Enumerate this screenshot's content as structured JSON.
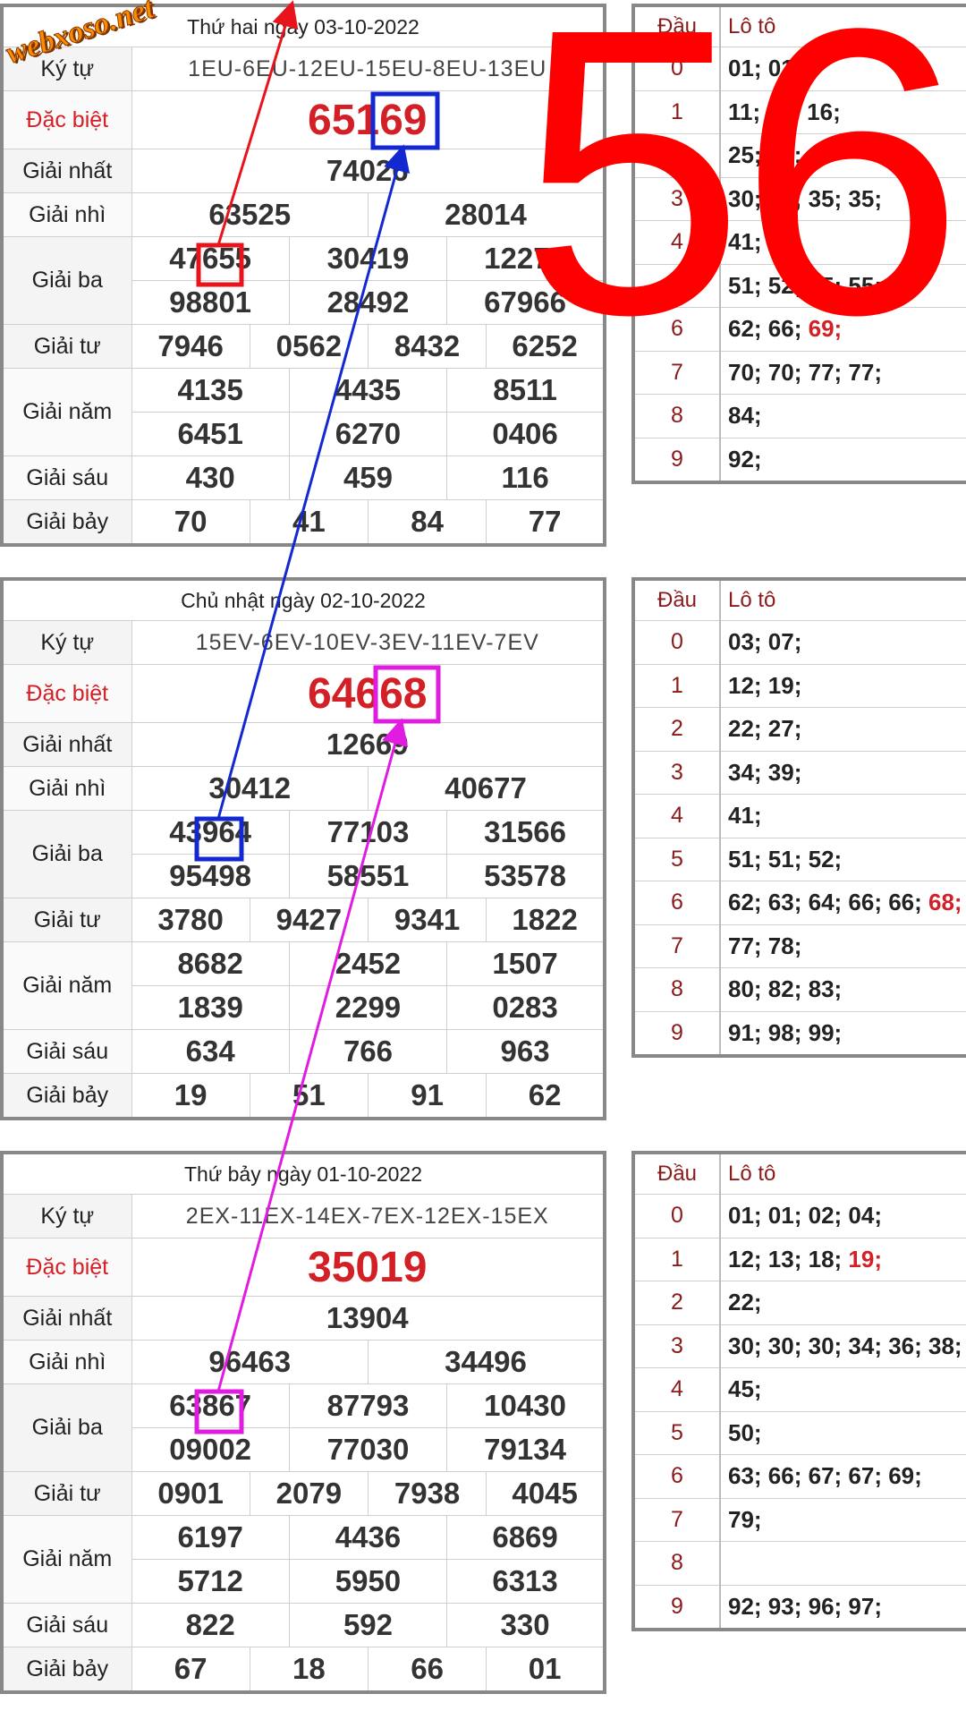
{
  "overlay": {
    "big_number": "56",
    "logo_text": "webxoso.net"
  },
  "labels": {
    "ky_tu": "Ký tự",
    "dac_biet": "Đặc biệt",
    "giai_nhat": "Giải nhất",
    "giai_nhi": "Giải nhì",
    "giai_ba": "Giải ba",
    "giai_tu": "Giải tư",
    "giai_nam": "Giải năm",
    "giai_sau": "Giải sáu",
    "giai_bay": "Giải bảy",
    "dau": "Đầu",
    "loto": "Lô tô"
  },
  "days": [
    {
      "date_title": "Thứ hai ngày 03-10-2022",
      "ky_tu": "1EU-6EU-12EU-15EU-8EU-13EU",
      "dac_biet": "65169",
      "giai_nhat": "74026",
      "giai_nhi": [
        "63525",
        "28014"
      ],
      "giai_ba": [
        "47655",
        "30419",
        "12277",
        "98801",
        "28492",
        "67966"
      ],
      "giai_tu": [
        "7946",
        "0562",
        "8432",
        "6252"
      ],
      "giai_nam": [
        "4135",
        "4435",
        "8511",
        "6451",
        "6270",
        "0406"
      ],
      "giai_sau": [
        "430",
        "459",
        "116"
      ],
      "giai_bay": [
        "70",
        "41",
        "84",
        "77"
      ],
      "loto": [
        {
          "dau": "0",
          "values": "01; 01;",
          "hl": ""
        },
        {
          "dau": "1",
          "values": "11; 14; 16;",
          "hl": ""
        },
        {
          "dau": "2",
          "values": "25; 26;",
          "hl": ""
        },
        {
          "dau": "3",
          "values": "30; 32; 35; 35;",
          "hl": ""
        },
        {
          "dau": "4",
          "values": "41;",
          "hl": ""
        },
        {
          "dau": "5",
          "values": "51; 52; 55; 55;",
          "hl": ""
        },
        {
          "dau": "6",
          "values": "62; 66; ",
          "hl": "69;"
        },
        {
          "dau": "7",
          "values": "70; 70; 77; 77;",
          "hl": ""
        },
        {
          "dau": "8",
          "values": "84;",
          "hl": ""
        },
        {
          "dau": "9",
          "values": "92;",
          "hl": ""
        }
      ]
    },
    {
      "date_title": "Chủ nhật ngày 02-10-2022",
      "ky_tu": "15EV-6EV-10EV-3EV-11EV-7EV",
      "dac_biet": "64668",
      "giai_nhat": "12669",
      "giai_nhi": [
        "30412",
        "40677"
      ],
      "giai_ba": [
        "43964",
        "77103",
        "31566",
        "95498",
        "58551",
        "53578"
      ],
      "giai_tu": [
        "3780",
        "9427",
        "9341",
        "1822"
      ],
      "giai_nam": [
        "8682",
        "2452",
        "1507",
        "1839",
        "2299",
        "0283"
      ],
      "giai_sau": [
        "634",
        "766",
        "963"
      ],
      "giai_bay": [
        "19",
        "51",
        "91",
        "62"
      ],
      "loto": [
        {
          "dau": "0",
          "values": "03; 07;",
          "hl": ""
        },
        {
          "dau": "1",
          "values": "12; 19;",
          "hl": ""
        },
        {
          "dau": "2",
          "values": "22; 27;",
          "hl": ""
        },
        {
          "dau": "3",
          "values": "34; 39;",
          "hl": ""
        },
        {
          "dau": "4",
          "values": "41;",
          "hl": ""
        },
        {
          "dau": "5",
          "values": "51; 51; 52;",
          "hl": ""
        },
        {
          "dau": "6",
          "values": "62; 63; 64; 66; 66; ",
          "hl": "68;"
        },
        {
          "dau": "7",
          "values": "77; 78;",
          "hl": ""
        },
        {
          "dau": "8",
          "values": "80; 82; 83;",
          "hl": ""
        },
        {
          "dau": "9",
          "values": "91; 98; 99;",
          "hl": ""
        }
      ]
    },
    {
      "date_title": "Thứ bảy ngày 01-10-2022",
      "ky_tu": "2EX-11EX-14EX-7EX-12EX-15EX",
      "dac_biet": "35019",
      "giai_nhat": "13904",
      "giai_nhi": [
        "96463",
        "34496"
      ],
      "giai_ba": [
        "63867",
        "87793",
        "10430",
        "09002",
        "77030",
        "79134"
      ],
      "giai_tu": [
        "0901",
        "2079",
        "7938",
        "4045"
      ],
      "giai_nam": [
        "6197",
        "4436",
        "6869",
        "5712",
        "5950",
        "6313"
      ],
      "giai_sau": [
        "822",
        "592",
        "330"
      ],
      "giai_bay": [
        "67",
        "18",
        "66",
        "01"
      ],
      "loto": [
        {
          "dau": "0",
          "values": "01; 01; 02; 04;",
          "hl": ""
        },
        {
          "dau": "1",
          "values": "12; 13; 18; ",
          "hl": "19;"
        },
        {
          "dau": "2",
          "values": "22;",
          "hl": ""
        },
        {
          "dau": "3",
          "values": "30; 30; 30; 34; 36; 38;",
          "hl": ""
        },
        {
          "dau": "4",
          "values": "45;",
          "hl": ""
        },
        {
          "dau": "5",
          "values": "50;",
          "hl": ""
        },
        {
          "dau": "6",
          "values": "63; 66; 67; 67; 69;",
          "hl": ""
        },
        {
          "dau": "7",
          "values": "79;",
          "hl": ""
        },
        {
          "dau": "8",
          "values": "",
          "hl": ""
        },
        {
          "dau": "9",
          "values": "92; 93; 96; 97;",
          "hl": ""
        }
      ]
    }
  ],
  "colors": {
    "red_arrow": "#e8141c",
    "blue_arrow": "#1428d2",
    "magenta_arrow": "#e01ce0",
    "accent": "#d31f26"
  }
}
